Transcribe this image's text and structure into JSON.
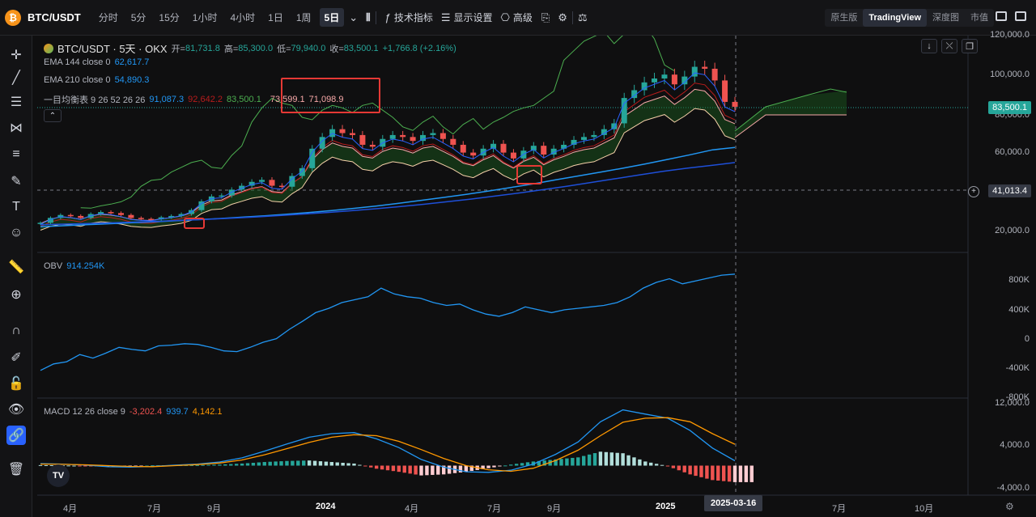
{
  "topbar": {
    "coin_glyph": "₿",
    "symbol": "BTC/USDT",
    "intervals": [
      "分时",
      "5分",
      "15分",
      "1小时",
      "4小时",
      "1日",
      "1周",
      "5日"
    ],
    "active_interval": "5日",
    "indicators_label": "技术指标",
    "display_settings_label": "显示设置",
    "advanced_label": "高级",
    "views": [
      "原生版",
      "TradingView",
      "深度图",
      "市值"
    ],
    "active_view": "TradingView"
  },
  "legend": {
    "title": "BTC/USDT · 5天 · OKX",
    "open_label": "开=",
    "open": "81,731.8",
    "high_label": "高=",
    "high": "85,300.0",
    "low_label": "低=",
    "low": "79,940.0",
    "close_label": "收=",
    "close": "83,500.1",
    "change": "+1,766.8 (+2.16%)",
    "ema144_label": "EMA 144 close 0",
    "ema144_value": "62,617.7",
    "ema210_label": "EMA 210 close 0",
    "ema210_value": "54,890.3",
    "ichimoku_label": "一目均衡表 9 26 52 26 26",
    "ichimoku_values": [
      "91,087.3",
      "92,642.2",
      "83,500.1",
      "73,599.1",
      "71,098.9"
    ],
    "obv_label": "OBV",
    "obv_value": "914.254K",
    "macd_label": "MACD 12 26 close 9",
    "macd_values": [
      "-3,202.4",
      "939.7",
      "4,142.1"
    ]
  },
  "price_axis": {
    "main": [
      "120,000.0",
      "100,000.0",
      "80,000.0",
      "60,000.0",
      "40,000.0",
      "20,000.0"
    ],
    "current_price": "83,500.1",
    "crosshair_price": "41,013.4",
    "obv": [
      "800K",
      "400K",
      "0",
      "-400K",
      "-800K"
    ],
    "macd": [
      "12,000.0",
      "4,000.0",
      "-4,000.0"
    ]
  },
  "time_axis": {
    "labels": [
      "4月",
      "7月",
      "9月",
      "2024",
      "4月",
      "7月",
      "9月",
      "2025",
      "7月",
      "10月"
    ],
    "crosshair_date": "2025-03-16"
  },
  "colors": {
    "up": "#26a69a",
    "down": "#ef5350",
    "ema144": "#2196f3",
    "ema210": "#1e4fd8",
    "obv": "#2196f3",
    "macd_line": "#2196f3",
    "signal_line": "#ff9800",
    "ichi_lead": "#4caf50",
    "ichi_base": "#b71c1c",
    "ichi_conv": "#2962ff",
    "cloud_green": "#1b5e20",
    "cloud_red": "#4a1414",
    "highlight": "#e53935"
  },
  "icons": [
    "crosshair-icon",
    "trendline-icon",
    "fib-icon",
    "pattern-icon",
    "measure-icon",
    "brush-icon",
    "text-icon",
    "emoji-icon",
    "ruler-icon",
    "zoom-icon",
    "magnet-icon",
    "pen-lock-icon",
    "lock-icon",
    "eye-icon",
    "link-icon",
    "trash-icon"
  ],
  "chart_data": {
    "type": "line",
    "title": "BTC/USDT · 5天 · OKX",
    "price_ylim": [
      20000,
      120000
    ],
    "close_series": [
      24000,
      26500,
      28000,
      27500,
      26500,
      28500,
      29500,
      29000,
      28000,
      26500,
      26000,
      25800,
      26800,
      27500,
      28500,
      30500,
      35000,
      37500,
      38000,
      41000,
      43000,
      45000,
      46000,
      43000,
      42500,
      48000,
      52000,
      62000,
      68000,
      72000,
      70000,
      69000,
      64000,
      63000,
      67000,
      69000,
      68000,
      66000,
      69000,
      70000,
      67000,
      64000,
      60000,
      58500,
      62000,
      64500,
      60000,
      57000,
      61000,
      63500,
      59000,
      62000,
      64000,
      66500,
      68000,
      69000,
      72000,
      75000,
      88000,
      92000,
      96000,
      98000,
      100000,
      95000,
      99000,
      104000,
      103000,
      97000,
      86000,
      83500
    ],
    "ema144": [
      22000,
      22500,
      23000,
      23500,
      24000,
      24500,
      25000,
      25600,
      26200,
      26900,
      27600,
      28400,
      29300,
      30300,
      31400,
      32600,
      34000,
      35500,
      37000,
      38600,
      40300,
      42100,
      44000,
      46000,
      48000,
      50000,
      52000,
      54200,
      56500,
      58900,
      61400,
      62617.7
    ],
    "ema210": [
      23000,
      23300,
      23600,
      24000,
      24400,
      24800,
      25300,
      25800,
      26400,
      27000,
      27700,
      28500,
      29300,
      30200,
      31200,
      32300,
      33500,
      34800,
      36200,
      37700,
      39300,
      41000,
      42800,
      44700,
      46600,
      48500,
      50400,
      52000,
      53400,
      54890.3
    ],
    "obv_series": [
      -420,
      -330,
      -300,
      -200,
      -250,
      -180,
      -100,
      -130,
      -150,
      -80,
      -70,
      -50,
      -60,
      -100,
      -150,
      -160,
      -100,
      -30,
      20,
      150,
      260,
      380,
      440,
      520,
      560,
      600,
      720,
      640,
      600,
      580,
      520,
      480,
      500,
      420,
      360,
      330,
      380,
      460,
      420,
      380,
      420,
      440,
      460,
      480,
      520,
      600,
      720,
      800,
      850,
      780,
      820,
      860,
      900,
      914.254
    ],
    "macd_line": [
      400,
      300,
      100,
      -200,
      -300,
      -150,
      100,
      300,
      700,
      1500,
      2800,
      4200,
      5500,
      6200,
      6400,
      5200,
      3500,
      1200,
      -300,
      -1200,
      -1300,
      -900,
      300,
      2200,
      4600,
      8500,
      10800,
      10000,
      9200,
      6800,
      3400,
      939.7
    ],
    "signal_line": [
      300,
      250,
      150,
      0,
      -150,
      -200,
      0,
      200,
      500,
      1100,
      2100,
      3300,
      4500,
      5500,
      6000,
      5800,
      4700,
      3100,
      1400,
      0,
      -800,
      -1100,
      -500,
      1000,
      3000,
      5800,
      8400,
      9200,
      9300,
      8500,
      6200,
      4142.1
    ],
    "macd_histogram": [
      100,
      50,
      -50,
      -200,
      -150,
      50,
      100,
      100,
      200,
      400,
      700,
      900,
      1000,
      700,
      400,
      -600,
      -1200,
      -1900,
      -1700,
      -1200,
      -500,
      200,
      800,
      1200,
      1600,
      2700,
      2400,
      800,
      -100,
      -1700,
      -2800,
      -3202.4
    ]
  }
}
